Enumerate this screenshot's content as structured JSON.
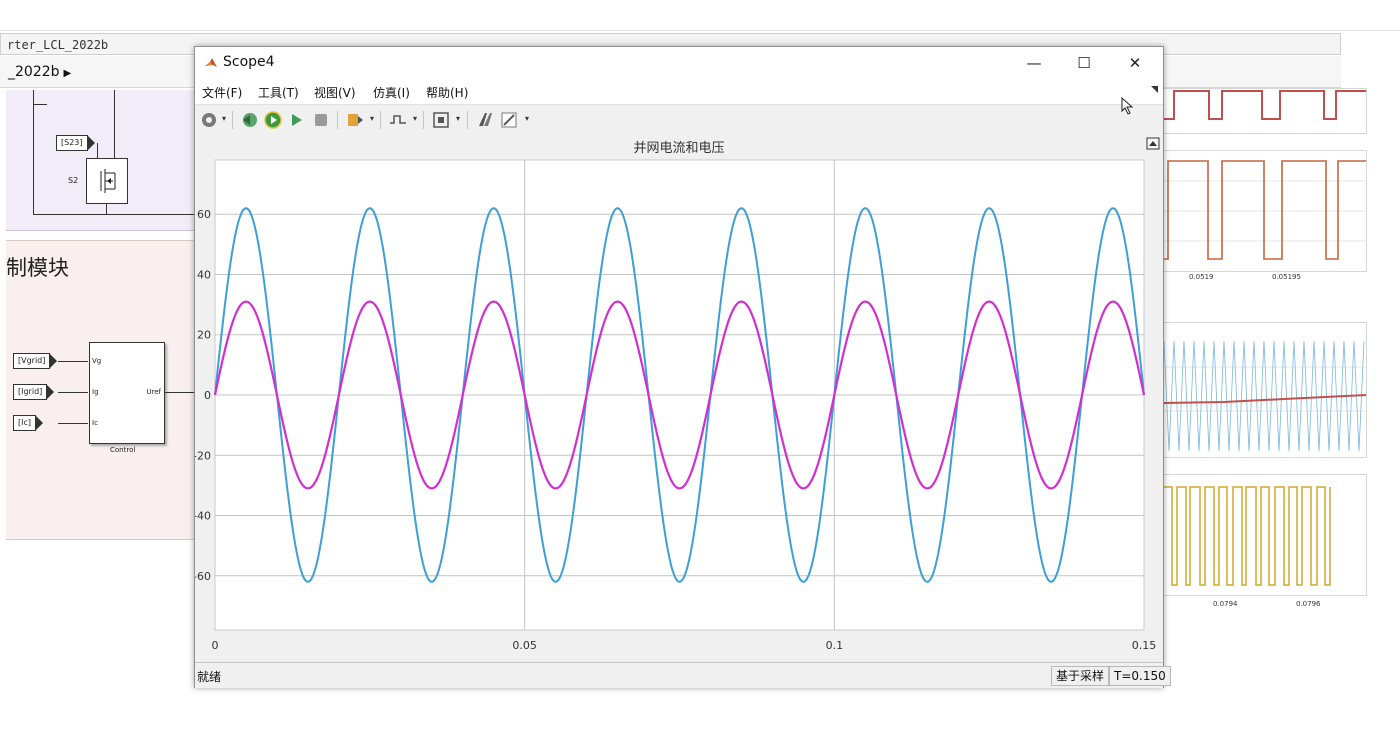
{
  "background": {
    "tab_title": "rter_LCL_2022b",
    "breadcrumb": "_2022b",
    "control_section_title": "制模块",
    "power_tag": "[S23]",
    "switch_label": "S2",
    "control_inputs": [
      "[Vgrid]",
      "[Igrid]",
      "[Ic]"
    ],
    "control_ports_in": [
      "Vg",
      "Ig",
      "Ic"
    ],
    "control_port_out": "Uref",
    "control_block_name": "Control",
    "right_scope_ticks_top": [
      "0.0519",
      "0.05195"
    ],
    "right_scope_ticks_bottom": [
      "0.0794",
      "0.0796"
    ]
  },
  "window": {
    "title": "Scope4",
    "minimize": "—",
    "maximize": "☐",
    "close": "✕"
  },
  "menu": [
    "文件(F)",
    "工具(T)",
    "视图(V)",
    "仿真(I)",
    "帮助(H)"
  ],
  "toolbar_icons": [
    "settings-icon",
    "step-back-icon",
    "run-icon",
    "step-forward-icon",
    "stop-icon",
    "highlight-icon",
    "trigger-icon",
    "zoom-fit-icon",
    "scope-style-icon",
    "edit-icon"
  ],
  "status": {
    "left": "就绪",
    "mode": "基于采样",
    "time": "T=0.150"
  },
  "chart_data": {
    "type": "line",
    "title": "并网电流和电压",
    "xlabel": "",
    "ylabel": "",
    "xlim": [
      0,
      0.15
    ],
    "ylim": [
      -78,
      78
    ],
    "x_ticks": [
      0,
      0.05,
      0.1,
      0.15
    ],
    "x_tick_labels": [
      "0",
      "0.05",
      "0.1",
      "0.15"
    ],
    "y_ticks": [
      -60,
      -40,
      -20,
      0,
      20,
      40,
      60
    ],
    "y_tick_labels": [
      "-60",
      "-40",
      "-20",
      "0",
      "20",
      "40",
      "60"
    ],
    "grid": true,
    "background": "#ffffff",
    "series": [
      {
        "color": "#3d9fd6",
        "amplitude": 62,
        "frequency_hz": 50,
        "phase_deg": 0,
        "x_start": 0,
        "x_end": 0.15
      },
      {
        "color": "#d12fd0",
        "amplitude": 31,
        "frequency_hz": 50,
        "phase_deg": 0,
        "x_start": 0,
        "x_end": 0.15
      }
    ]
  },
  "colors": {
    "scope_blue": "#3d9fd6",
    "scope_magenta": "#d12fd0",
    "right_scope_red": "#c0504d",
    "right_scope_orange": "#c8643c",
    "right_scope_yellow": "#d4a62a",
    "right_scope_light_blue": "#7ab8dc"
  }
}
